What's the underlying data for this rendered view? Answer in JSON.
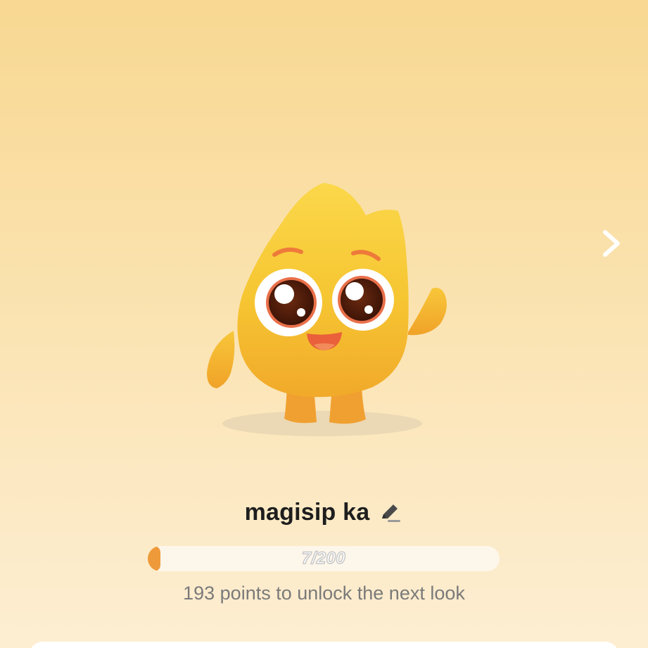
{
  "pet": {
    "name": "magisip ka",
    "edit_icon": "pencil-icon"
  },
  "navigation": {
    "next_icon": "chevron-right-icon"
  },
  "progress": {
    "current": 7,
    "max": 200,
    "label": "7/200",
    "fill_color": "#EE9A3A"
  },
  "unlock_message": "193 points to unlock the next look",
  "colors": {
    "background_top": "#F8D892",
    "background_bottom": "#FDEED2",
    "mascot_body": "#F6C532",
    "accent_orange": "#EE9A3A"
  }
}
